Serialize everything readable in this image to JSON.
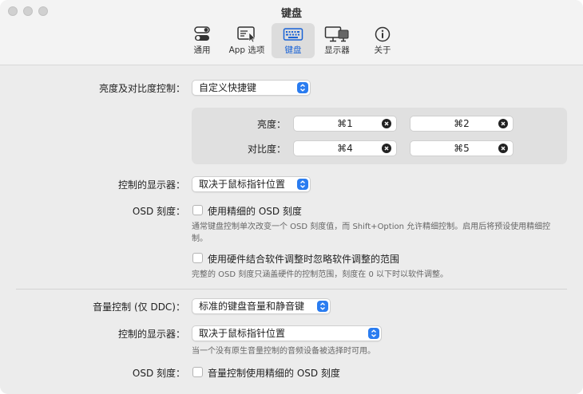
{
  "window": {
    "title": "键盘"
  },
  "toolbar": {
    "items": [
      {
        "label": "通用",
        "icon": "switch-icon"
      },
      {
        "label": "App 选项",
        "icon": "app-window-icon"
      },
      {
        "label": "键盘",
        "icon": "keyboard-icon",
        "active": true
      },
      {
        "label": "显示器",
        "icon": "displays-icon"
      },
      {
        "label": "关于",
        "icon": "info-icon"
      }
    ],
    "accent": "#1a63d6"
  },
  "brightness": {
    "label": "亮度及对比度控制：",
    "selected": "自定义快捷键",
    "shortcuts": {
      "brightness_label": "亮度：",
      "contrast_label": "对比度：",
      "brightness_down": "⌘1",
      "brightness_up": "⌘2",
      "contrast_down": "⌘4",
      "contrast_up": "⌘5"
    },
    "display_label": "控制的显示器：",
    "display_selected": "取决于鼠标指针位置",
    "osd_label": "OSD 刻度：",
    "fine_osd": "使用精细的 OSD 刻度",
    "fine_osd_note": "通常键盘控制单次改变一个 OSD 刻度值，而 Shift+Option 允许精细控制。启用后将预设使用精细控制。",
    "hw_sw": "使用硬件结合软件调整时忽略软件调整的范围",
    "hw_sw_note": "完整的 OSD 刻度只涵盖硬件的控制范围，刻度在 0 以下时以软件调整。"
  },
  "volume": {
    "label": "音量控制 (仅 DDC)：",
    "selected": "标准的键盘音量和静音键",
    "display_label": "控制的显示器：",
    "display_selected": "取决于鼠标指针位置",
    "display_note": "当一个没有原生音量控制的音频设备被选择时可用。",
    "osd_label": "OSD 刻度：",
    "fine_osd": "音量控制使用精细的 OSD 刻度"
  },
  "colors": {
    "stepper": "#2a7cf0",
    "window_bg": "#ececec"
  }
}
